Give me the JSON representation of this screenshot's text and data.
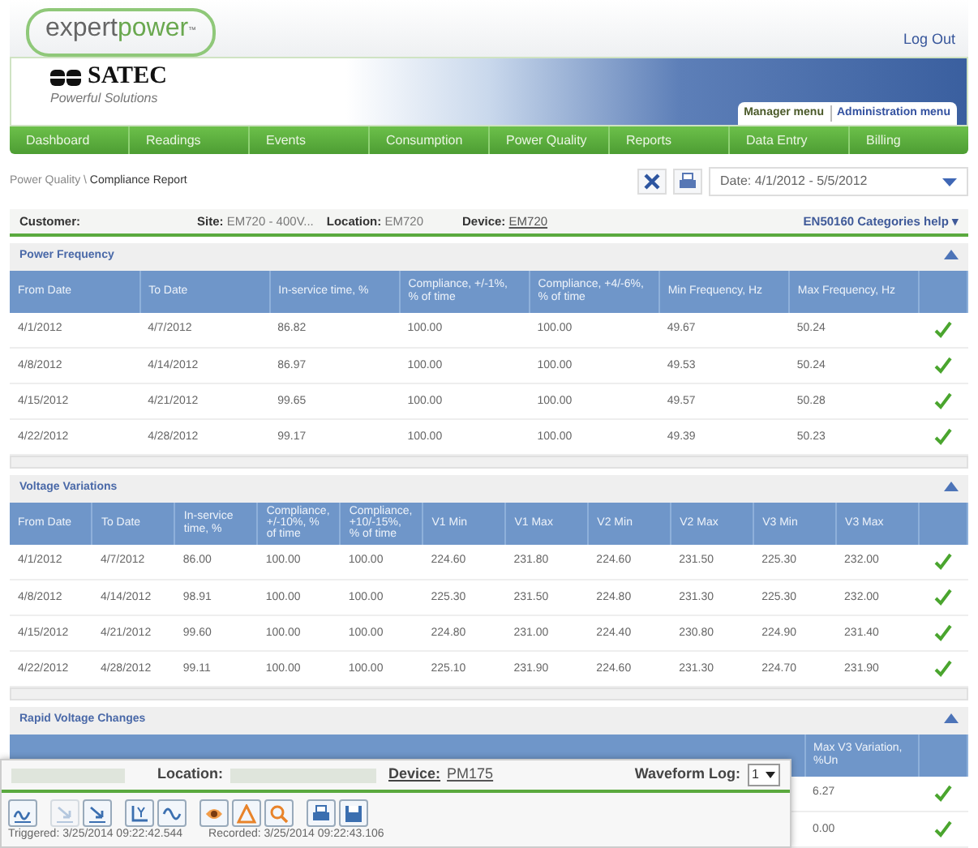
{
  "header": {
    "logo_text_a": "expert",
    "logo_text_b": "power",
    "logo_mark": "™",
    "logout": "Log Out"
  },
  "banner": {
    "brand": "SATEC",
    "tagline": "Powerful Solutions",
    "menus": [
      {
        "label": "Manager menu",
        "selected": true
      },
      {
        "label": "Administration menu",
        "selected": false
      }
    ]
  },
  "nav": [
    "Dashboard",
    "Readings",
    "Events",
    "Consumption",
    "Power Quality",
    "Reports",
    "Data Entry",
    "Billing"
  ],
  "breadcrumb": {
    "parent": "Power Quality \\",
    "current": "Compliance Report"
  },
  "date_filter": {
    "value": "Date: 4/1/2012 - 5/5/2012"
  },
  "info_bar": {
    "customer_label": "Customer:",
    "site_label": "Site:",
    "site_value": "EM720 - 400V...",
    "location_label": "Location:",
    "location_value": "EM720",
    "device_label": "Device:",
    "device_value": "EM720",
    "help": "EN50160 Categories help ▾"
  },
  "sections": [
    {
      "title": "Power Frequency",
      "expanded": true,
      "columns": [
        "From Date",
        "To Date",
        "In-service time, %",
        "Compliance, +/-1%, % of time",
        "Compliance, +4/-6%, % of time",
        "Min Frequency, Hz",
        "Max Frequency, Hz"
      ],
      "rows": [
        {
          "cells": [
            "4/1/2012",
            "4/7/2012",
            "86.82",
            "100.00",
            "100.00",
            "49.67",
            "50.24"
          ],
          "compliant": true
        },
        {
          "cells": [
            "4/8/2012",
            "4/14/2012",
            "86.97",
            "100.00",
            "100.00",
            "49.53",
            "50.24"
          ],
          "compliant": true
        },
        {
          "cells": [
            "4/15/2012",
            "4/21/2012",
            "99.65",
            "100.00",
            "100.00",
            "49.57",
            "50.28"
          ],
          "compliant": true
        },
        {
          "cells": [
            "4/22/2012",
            "4/28/2012",
            "99.17",
            "100.00",
            "100.00",
            "49.39",
            "50.23"
          ],
          "compliant": true
        }
      ]
    },
    {
      "title": "Voltage Variations",
      "expanded": true,
      "columns": [
        "From Date",
        "To Date",
        "In-service time, %",
        "Compliance, +/-10%, % of time",
        "Compliance, +10/-15%, % of time",
        "V1 Min",
        "V1 Max",
        "V2 Min",
        "V2 Max",
        "V3 Min",
        "V3 Max"
      ],
      "rows": [
        {
          "cells": [
            "4/1/2012",
            "4/7/2012",
            "86.00",
            "100.00",
            "100.00",
            "224.60",
            "231.80",
            "224.60",
            "231.50",
            "225.30",
            "232.00"
          ],
          "compliant": true
        },
        {
          "cells": [
            "4/8/2012",
            "4/14/2012",
            "98.91",
            "100.00",
            "100.00",
            "225.30",
            "231.50",
            "224.80",
            "231.30",
            "225.30",
            "232.00"
          ],
          "compliant": true
        },
        {
          "cells": [
            "4/15/2012",
            "4/21/2012",
            "99.60",
            "100.00",
            "100.00",
            "224.80",
            "231.00",
            "224.40",
            "230.80",
            "224.90",
            "231.40"
          ],
          "compliant": true
        },
        {
          "cells": [
            "4/22/2012",
            "4/28/2012",
            "99.11",
            "100.00",
            "100.00",
            "225.10",
            "231.90",
            "224.60",
            "231.30",
            "224.70",
            "231.90"
          ],
          "compliant": true
        }
      ]
    }
  ],
  "rapid": {
    "title": "Rapid Voltage Changes",
    "expanded": true,
    "column": "Max V3 Variation, %Un",
    "rows": [
      {
        "cell": "6.27",
        "compliant": true
      },
      {
        "cell": "0.00",
        "compliant": true
      }
    ]
  },
  "waveform_panel": {
    "location_label": "Location:",
    "device_label": "Device:",
    "device_value": "PM175",
    "log_label": "Waveform Log:",
    "log_value": "1",
    "tools": [
      {
        "disabled": false
      },
      {
        "disabled": true
      },
      {
        "disabled": false
      },
      {
        "disabled": false
      },
      {
        "disabled": false
      },
      {
        "disabled": false
      },
      {
        "disabled": false
      },
      {
        "disabled": false
      },
      {
        "disabled": false
      },
      {
        "disabled": false
      }
    ],
    "triggered": "Triggered: 3/25/2014 09:22:42.544",
    "recorded": "Recorded: 3/25/2014 09:22:43.106"
  }
}
